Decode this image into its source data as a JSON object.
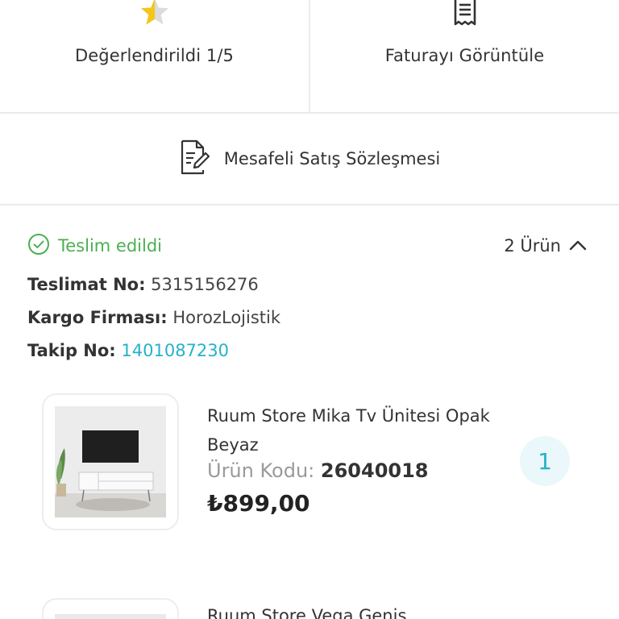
{
  "actions": {
    "rated_label": "Değerlendirildi 1/5",
    "rating_value": 1,
    "rating_max": 5,
    "invoice_label": "Faturayı Görüntüle",
    "contract_label": "Mesafeli Satış Sözleşmesi"
  },
  "shipment": {
    "status": "Teslim edildi",
    "item_count": "2 Ürün",
    "delivery_no_key": "Teslimat No:",
    "delivery_no": "5315156276",
    "carrier_key": "Kargo Firması:",
    "carrier": "HorozLojistik",
    "tracking_key": "Takip No:",
    "tracking_no": "1401087230"
  },
  "products": [
    {
      "name": "Ruum Store Mika Tv Ünitesi Opak Beyaz",
      "code_label": "Ürün Kodu:",
      "code": "26040018",
      "price": "₺899,00",
      "quantity": "1"
    },
    {
      "name": "Ruum Store Vega Geniş"
    }
  ],
  "colors": {
    "accent": "#26b2c8",
    "success": "#4caf50",
    "star": "#f5c518",
    "divider": "#ebebeb"
  },
  "icons": [
    "star-icon",
    "receipt-icon",
    "contract-icon",
    "check-circle-icon",
    "chevron-up-icon"
  ]
}
